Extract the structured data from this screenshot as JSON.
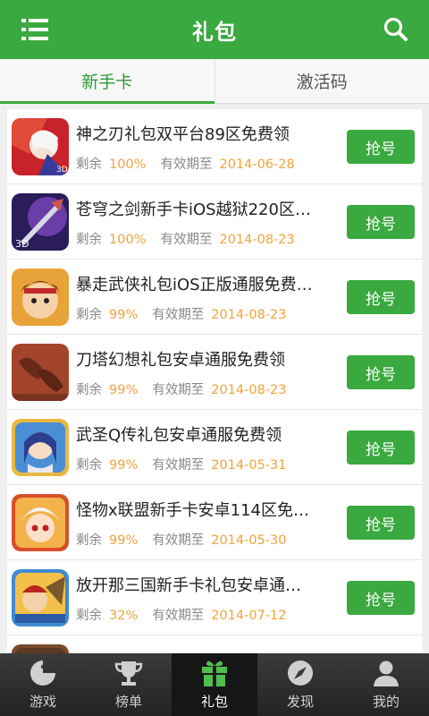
{
  "header": {
    "title": "礼包",
    "menu_icon": "menu-icon",
    "search_icon": "search-icon"
  },
  "tabs": [
    {
      "label": "新手卡",
      "active": true
    },
    {
      "label": "激活码",
      "active": false
    }
  ],
  "list": {
    "remain_label": "剩余",
    "expire_label": "有效期至",
    "button_label": "抢号",
    "items": [
      {
        "name": "神之刃礼包双平台89区免费领",
        "remain": "100%",
        "expire": "2014-06-28"
      },
      {
        "name": "苍穹之剑新手卡iOS越狱220区…",
        "remain": "100%",
        "expire": "2014-08-23"
      },
      {
        "name": "暴走武侠礼包iOS正版通服免费…",
        "remain": "99%",
        "expire": "2014-08-23"
      },
      {
        "name": "刀塔幻想礼包安卓通服免费领",
        "remain": "99%",
        "expire": "2014-08-23"
      },
      {
        "name": "武圣Q传礼包安卓通服免费领",
        "remain": "99%",
        "expire": "2014-05-31"
      },
      {
        "name": "怪物x联盟新手卡安卓114区免…",
        "remain": "99%",
        "expire": "2014-05-30"
      },
      {
        "name": "放开那三国新手卡礼包安卓通…",
        "remain": "32%",
        "expire": "2014-07-12"
      }
    ]
  },
  "bottom_nav": [
    {
      "label": "游戏",
      "icon": "pacman-icon",
      "active": false
    },
    {
      "label": "榜单",
      "icon": "trophy-icon",
      "active": false
    },
    {
      "label": "礼包",
      "icon": "gift-icon",
      "active": true
    },
    {
      "label": "发现",
      "icon": "compass-icon",
      "active": false
    },
    {
      "label": "我的",
      "icon": "user-icon",
      "active": false
    }
  ],
  "colors": {
    "accent": "#3aa93f",
    "value": "#f1a33a",
    "navbar": "#2b2b2b"
  }
}
